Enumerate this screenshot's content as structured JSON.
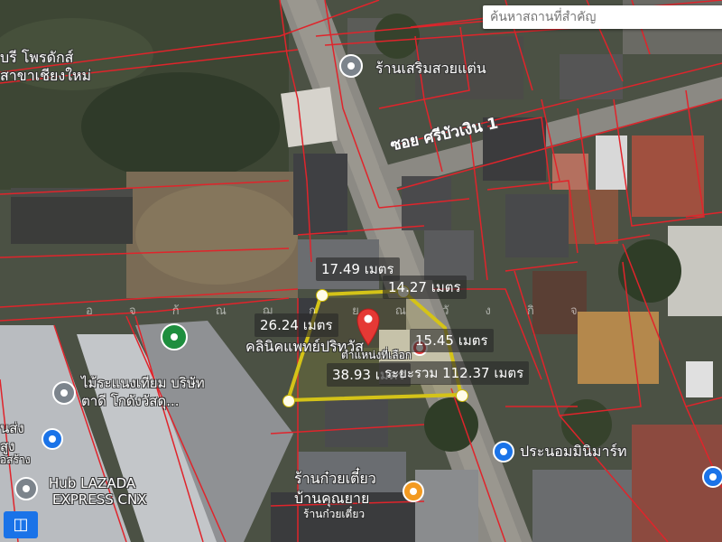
{
  "search": {
    "placeholder": "ค้นหาสถานที่สำคัญ"
  },
  "colors": {
    "boundary": "#e0242b",
    "measure_polygon": "#d4c318",
    "marker": "#e53935"
  },
  "measurements": {
    "top_left": "17.49 เมตร",
    "top_right": "14.27 เมตร",
    "left": "26.24 เมตร",
    "right": "15.45 เมตร",
    "bottom": "38.93 เมตร",
    "total": "ระยะรวม 112.37 เมตร"
  },
  "places": {
    "porduct_top": "บรี โพรดักส์",
    "branch_cm": "สาขาเชียงใหม่",
    "salon": "ร้านเสริมสวยแต่น",
    "clinic": "คลินิคแพทย์ปริทวัส",
    "selected_position": "ตำแหน่งที่เลือก",
    "fence_shop": "ไม้ระแนงเทียม บริษัท",
    "fence_shop_2": "ตาดี โกดังวัสดุ...",
    "left_partial_1": "นส่ง",
    "left_partial_2": "สูง",
    "left_partial_3": "อสร้าง",
    "hub_lazada": "Hub LAZADA",
    "express_cnx": "EXPRESS CNX",
    "noodle_shop": "ร้านก๋วยเตี๋ยว",
    "noodle_shop_2": "บ้านคุณยาย",
    "noodle_shop_3": "ร้านก๋วยเตี๋ยว",
    "minimart": "ประนอมมินิมาร์ท"
  },
  "roads": {
    "soi": "ซอย ศรีบัวเงิน 1"
  },
  "faint_text": "อ จ ก้ ณ ฌ ก ย ณ วั ง กิ จ",
  "icons": {
    "search": "search-icon",
    "place_pin": "map-pin-icon",
    "shopping": "shopping-bag-icon",
    "restaurant": "restaurant-icon",
    "layers": "layers-icon"
  }
}
